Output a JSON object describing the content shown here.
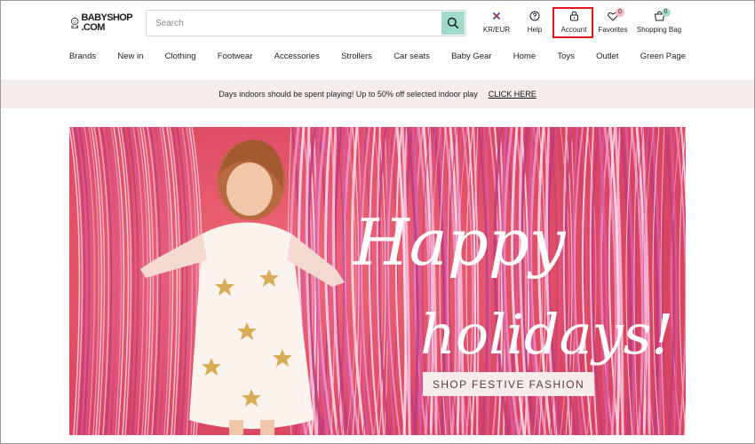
{
  "brand": {
    "logo_line1": "BABYSHOP",
    "logo_line2": ".COM"
  },
  "search": {
    "placeholder": "Search",
    "icon": "search-icon"
  },
  "utility": {
    "currency_label": "KR/EUR",
    "help_label": "Help",
    "account_label": "Account",
    "favorites_label": "Favorites",
    "favorites_count": "0",
    "bag_label": "Shopping Bag",
    "bag_count": "0"
  },
  "nav": {
    "items": [
      "Brands",
      "New in",
      "Clothing",
      "Footwear",
      "Accessories",
      "Strollers",
      "Car seats",
      "Baby Gear",
      "Home",
      "Toys",
      "Outlet",
      "Green Page"
    ]
  },
  "promo": {
    "text": "Days indoors should be spent playing! Up to 50% off selected indoor play",
    "link": "CLICK HERE"
  },
  "hero": {
    "headline_line1": "Happy",
    "headline_line2": "holidays!",
    "cta": "SHOP FESTIVE FASHION"
  },
  "colors": {
    "search_button": "#9fdacb",
    "promo_bg": "#f6eceb",
    "hero_bg": "#e2566a",
    "highlight": "#e0151b",
    "favorites_badge": "#f3b5be",
    "bag_badge": "#a8ddd0"
  }
}
